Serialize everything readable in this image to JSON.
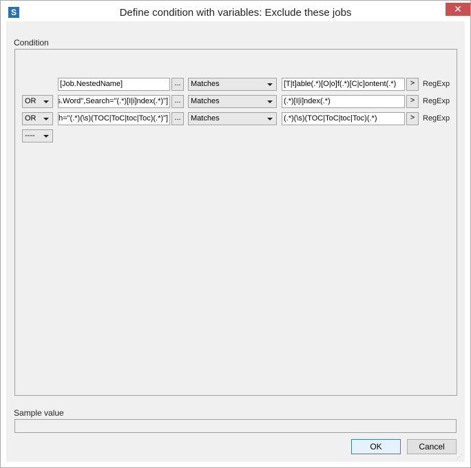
{
  "window": {
    "app_icon_letter": "S",
    "title": "Define condition with variables: Exclude these jobs",
    "close_glyph": "✕"
  },
  "condition": {
    "group_label": "Condition",
    "rows": [
      {
        "operator": "",
        "variable": "[Job.NestedName]",
        "browse_label": "...",
        "comparison": "Matches",
        "value": "[T|t]able(.*)[O|o]f(.*)[C|c]ontent(.*)",
        "expand_label": ">",
        "type": "RegExp"
      },
      {
        "operator": "OR",
        "variable": "[Stats.Word\",Search=\"(.*)[I|i]ndex(.*)\"]",
        "browse_label": "...",
        "comparison": "Matches",
        "value": "(.*)[I|i]ndex(.*)",
        "expand_label": ">",
        "type": "RegExp"
      },
      {
        "operator": "OR",
        "variable": "[Stats.Word\",Search=\"(.*)(\\s)(TOC|ToC|toc|Toc)(.*)\"]",
        "browse_label": "...",
        "comparison": "Matches",
        "value": "(.*)(\\s)(TOC|ToC|toc|Toc)(.*)",
        "expand_label": ">",
        "type": "RegExp"
      }
    ],
    "new_row_operator": "----"
  },
  "sample": {
    "label": "Sample value",
    "value": ""
  },
  "buttons": {
    "ok": "OK",
    "cancel": "Cancel"
  }
}
